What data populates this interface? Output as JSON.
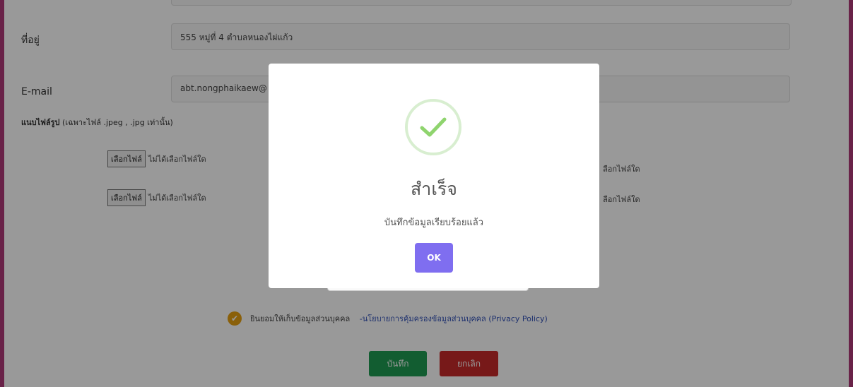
{
  "form": {
    "address_label": "ที่อยู่",
    "address_value": "555 หมู่ที่ 4 ตำบลหนองไผ่แก้ว",
    "email_label": "E-mail",
    "email_value": "abt.nongphaikaew@",
    "upload_title_bold": "แนบไฟล์รูป",
    "upload_title_hint": "(เฉพาะไฟล์ .jpeg , .jpg เท่านั้น)",
    "choose_file_label": "เลือกไฟล์",
    "no_file_text": "ไม่ได้เลือกไฟล์ใด",
    "no_file_text_partial": "ลือกไฟล์ใด"
  },
  "consent": {
    "text": "ยินยอมให้เก็บข้อมูลส่วนบุคคล",
    "link": "-นโยบายการคุ้มครองข้อมูลส่วนบุคคล (Privacy Policy)"
  },
  "buttons": {
    "save": "บันทึก",
    "cancel": "ยกเลิก"
  },
  "modal": {
    "title": "สำเร็จ",
    "message": "บันทึกข้อมูลเรียบร้อยแล้ว",
    "ok": "OK",
    "icon": "success-check-icon"
  },
  "colors": {
    "frame": "#b03a78",
    "save": "#1f9c52",
    "cancel": "#c62a2a",
    "ok": "#7f6ef0",
    "check": "#8fd46e",
    "consent_check": "#e6a012"
  }
}
